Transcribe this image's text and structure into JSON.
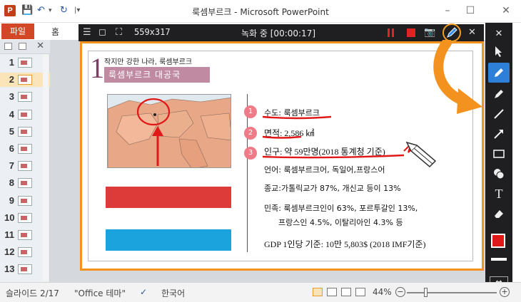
{
  "window": {
    "title": "룩셈부르크 - Microsoft PowerPoint",
    "app_icon": "P",
    "min": "–",
    "max": "☐",
    "close": "✕"
  },
  "quick_access": {
    "save": "💾",
    "undo": "↶",
    "undo_drop": "▾",
    "redo": "↻",
    "customize": "|▾"
  },
  "ribbon": {
    "file_tab": "파일",
    "home_tab": "홈"
  },
  "slide_pane": {
    "close": "✕",
    "slides": [
      "1",
      "2",
      "3",
      "4",
      "5",
      "6",
      "7",
      "8",
      "9",
      "10",
      "11",
      "12",
      "13"
    ],
    "active_index": 1
  },
  "recorder": {
    "menu": "☰",
    "window_icon": "◻",
    "crop_icon": "⛶",
    "size": "559x317",
    "status": "녹화 중 [00:00:17]",
    "camera": "📷",
    "close": "✕"
  },
  "slide": {
    "number": "1",
    "kicker": "작지만 강한 나라, 룩셈부르크",
    "title": "룩셈부르크 대공국",
    "badges": [
      "1",
      "2",
      "3"
    ],
    "capital": "수도: 룩셈부르크",
    "area": "면적: 2,586 ㎢",
    "population": "인구: 약 59만명(2018 통계청 기준)",
    "language": "언어: 룩셈부르크어, 독일어,프랑스어",
    "religion": "종교:가톨릭교가 87%, 개신교 등이 13%",
    "ethnic_1": "민족: 룩셈부르크인이 63%, 포르투갈인 13%,",
    "ethnic_2": "프랑스인 4.5%, 이탈리아인 4.3% 등",
    "gdp": "GDP 1인당 기준: 10만 5,803$ (2018 IMF기준)"
  },
  "annotation_colors": {
    "pen": "#e01818",
    "highlight": "#f3921f",
    "flag_red": "#dd3a3a",
    "flag_blue": "#1aa3dd"
  },
  "toolbar": {
    "close": "✕",
    "tools": [
      "select-arrow",
      "pen",
      "highlighter",
      "line",
      "arrow",
      "rectangle",
      "step-number",
      "text",
      "eraser"
    ],
    "text_tool": "T",
    "swap": "↔"
  },
  "statusbar": {
    "slide_info": "슬라이드 2/17",
    "theme": "\"Office 테마\"",
    "language": "한국어",
    "zoom": "44%",
    "zoom_out": "−",
    "zoom_in": "+"
  }
}
